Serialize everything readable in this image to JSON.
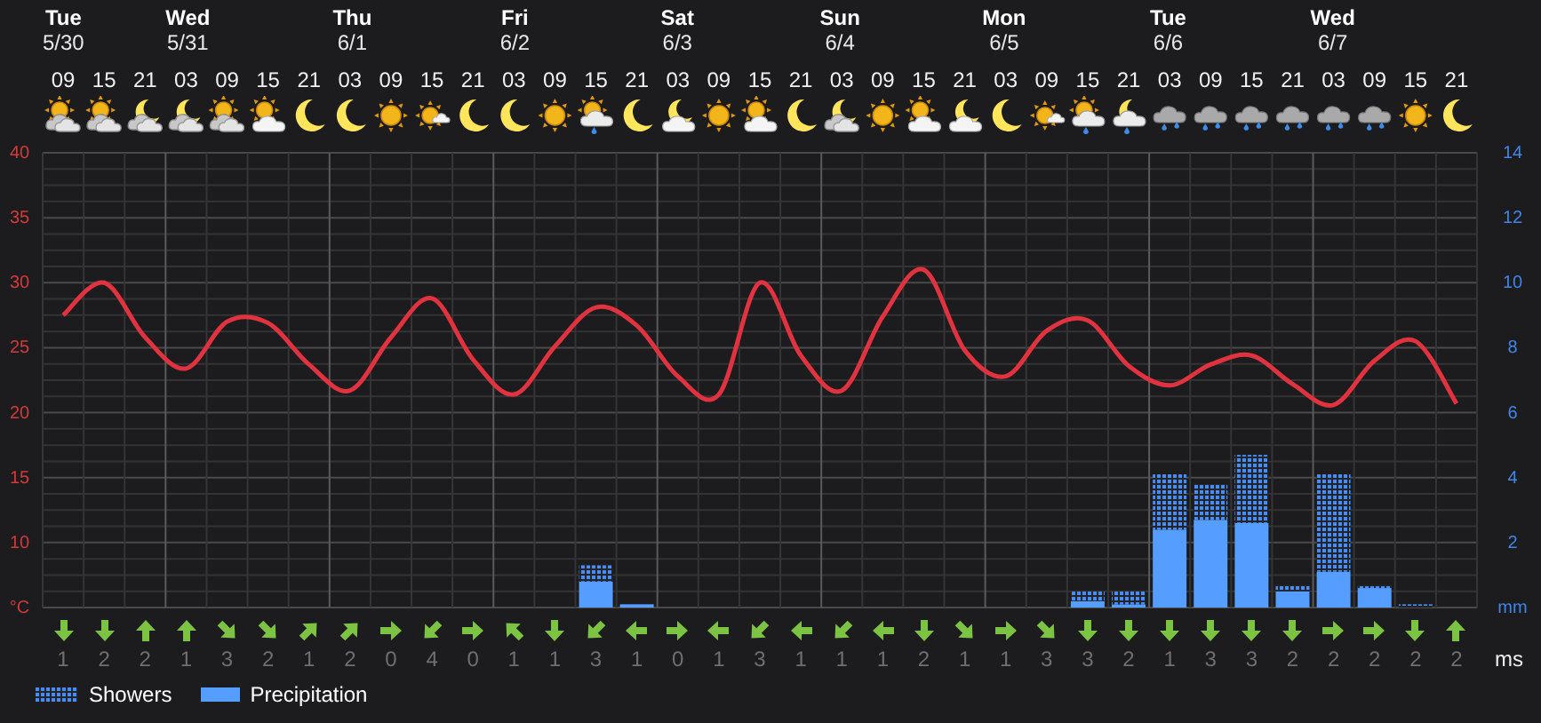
{
  "days": [
    {
      "day": "Tue",
      "date": "5/30",
      "slots": [
        {
          "kind": "sun-clouds",
          "wind": {
            "kind": "s",
            "speed": "1"
          }
        },
        {
          "kind": "sun-clouds",
          "wind": {
            "kind": "s",
            "speed": "2"
          }
        },
        {
          "kind": "moon-clouds",
          "wind": {
            "kind": "n",
            "speed": "2"
          }
        }
      ]
    },
    {
      "day": "Wed",
      "date": "5/31",
      "slots": [
        {
          "kind": "moon-clouds",
          "wind": {
            "kind": "n",
            "speed": "1"
          }
        },
        {
          "kind": "sun-clouds",
          "wind": {
            "kind": "se",
            "speed": "3"
          }
        },
        {
          "kind": "sun-cloud",
          "wind": {
            "kind": "se",
            "speed": "2"
          }
        },
        {
          "kind": "moon",
          "wind": {
            "kind": "ne",
            "speed": "1"
          }
        }
      ]
    },
    {
      "day": "Thu",
      "date": "6/1",
      "slots": [
        {
          "kind": "moon",
          "wind": {
            "kind": "ne",
            "speed": "2"
          }
        },
        {
          "kind": "sun",
          "wind": {
            "kind": "e",
            "speed": "0"
          }
        },
        {
          "kind": "sun-small-cloud",
          "wind": {
            "kind": "sw",
            "speed": "4"
          }
        },
        {
          "kind": "moon",
          "wind": {
            "kind": "e",
            "speed": "0"
          }
        }
      ]
    },
    {
      "day": "Fri",
      "date": "6/2",
      "slots": [
        {
          "kind": "moon",
          "wind": {
            "kind": "nw",
            "speed": "1"
          }
        },
        {
          "kind": "sun",
          "wind": {
            "kind": "s",
            "speed": "1"
          }
        },
        {
          "kind": "sun-cloud-rain",
          "wind": {
            "kind": "sw",
            "speed": "3"
          }
        },
        {
          "kind": "moon",
          "wind": {
            "kind": "w",
            "speed": "1"
          }
        }
      ]
    },
    {
      "day": "Sat",
      "date": "6/3",
      "slots": [
        {
          "kind": "moon-cloud",
          "wind": {
            "kind": "e",
            "speed": "0"
          }
        },
        {
          "kind": "sun",
          "wind": {
            "kind": "w",
            "speed": "1"
          }
        },
        {
          "kind": "sun-cloud",
          "wind": {
            "kind": "sw",
            "speed": "3"
          }
        },
        {
          "kind": "moon",
          "wind": {
            "kind": "w",
            "speed": "1"
          }
        }
      ]
    },
    {
      "day": "Sun",
      "date": "6/4",
      "slots": [
        {
          "kind": "moon-clouds",
          "wind": {
            "kind": "sw",
            "speed": "1"
          }
        },
        {
          "kind": "sun",
          "wind": {
            "kind": "w",
            "speed": "1"
          }
        },
        {
          "kind": "sun-cloud",
          "wind": {
            "kind": "s",
            "speed": "2"
          }
        },
        {
          "kind": "moon-cloud",
          "wind": {
            "kind": "se",
            "speed": "1"
          }
        }
      ]
    },
    {
      "day": "Mon",
      "date": "6/5",
      "slots": [
        {
          "kind": "moon",
          "wind": {
            "kind": "e",
            "speed": "1"
          }
        },
        {
          "kind": "sun-small-cloud",
          "wind": {
            "kind": "se",
            "speed": "3"
          }
        },
        {
          "kind": "sun-cloud-rain",
          "wind": {
            "kind": "s",
            "speed": "3"
          }
        },
        {
          "kind": "moon-cloud-rain",
          "wind": {
            "kind": "s",
            "speed": "2"
          }
        }
      ]
    },
    {
      "day": "Tue",
      "date": "6/6",
      "slots": [
        {
          "kind": "cloud-rain",
          "wind": {
            "kind": "s",
            "speed": "1"
          }
        },
        {
          "kind": "cloud-rain",
          "wind": {
            "kind": "s",
            "speed": "3"
          }
        },
        {
          "kind": "cloud-rain",
          "wind": {
            "kind": "s",
            "speed": "3"
          }
        },
        {
          "kind": "cloud-rain",
          "wind": {
            "kind": "s",
            "speed": "2"
          }
        }
      ]
    },
    {
      "day": "Wed",
      "date": "6/7",
      "slots": [
        {
          "kind": "cloud-rain",
          "wind": {
            "kind": "e",
            "speed": "2"
          }
        },
        {
          "kind": "cloud-rain",
          "wind": {
            "kind": "e",
            "speed": "2"
          }
        },
        {
          "kind": "sun",
          "wind": {
            "kind": "s",
            "speed": "2"
          }
        },
        {
          "kind": "moon",
          "wind": {
            "kind": "n",
            "speed": "2"
          }
        }
      ]
    }
  ],
  "wind_unit": "ms",
  "chart_data": {
    "type": "line",
    "categories": [
      "09",
      "15",
      "21",
      "03",
      "09",
      "15",
      "21",
      "03",
      "09",
      "15",
      "21",
      "03",
      "09",
      "15",
      "21",
      "03",
      "09",
      "15",
      "21",
      "03",
      "09",
      "15",
      "21",
      "03",
      "09",
      "15",
      "21",
      "03",
      "09",
      "15",
      "21",
      "03",
      "09",
      "15",
      "21"
    ],
    "series": [
      {
        "color": "#e0323f",
        "values": [
          27.5,
          30,
          25.8,
          23.4,
          27,
          26.9,
          23.7,
          21.7,
          25.8,
          28.8,
          24.1,
          21.4,
          25.1,
          28.1,
          26.7,
          22.8,
          21.4,
          30,
          24.4,
          21.7,
          27.4,
          31,
          24.8,
          22.8,
          26.3,
          27.1,
          23.6,
          22.1,
          23.7,
          24.4,
          22.2,
          20.6,
          24,
          25.5,
          20.7
        ]
      },
      {
        "name": "Showers",
        "type": "bar",
        "axis": "y2",
        "color": "#4a8cf0",
        "values": [
          null,
          null,
          null,
          null,
          null,
          null,
          null,
          null,
          null,
          null,
          null,
          null,
          null,
          0.5,
          null,
          null,
          null,
          null,
          null,
          null,
          null,
          null,
          null,
          null,
          null,
          0.3,
          0.4,
          1.7,
          1.1,
          2.1,
          0.2,
          3.0,
          0.1,
          0.1,
          null
        ]
      },
      {
        "name": "Precipitation",
        "type": "bar",
        "axis": "y2",
        "color": "#559dff",
        "values": [
          null,
          null,
          null,
          null,
          null,
          null,
          null,
          null,
          null,
          null,
          null,
          null,
          null,
          0.8,
          0.1,
          null,
          null,
          null,
          null,
          null,
          null,
          null,
          null,
          null,
          null,
          0.2,
          0.1,
          2.4,
          2.7,
          2.6,
          0.5,
          1.1,
          0.6,
          null,
          null
        ]
      }
    ],
    "stacked": true,
    "grid": true,
    "ylim": [
      5,
      40
    ],
    "yticks": [
      {
        "value": 5,
        "label": "°C"
      },
      10,
      15,
      20,
      25,
      30,
      35,
      40
    ],
    "y2lim": [
      0,
      14
    ],
    "y2ticks": [
      {
        "value": 0,
        "label": "mm"
      },
      2,
      4,
      6,
      8,
      10,
      12,
      14
    ]
  }
}
